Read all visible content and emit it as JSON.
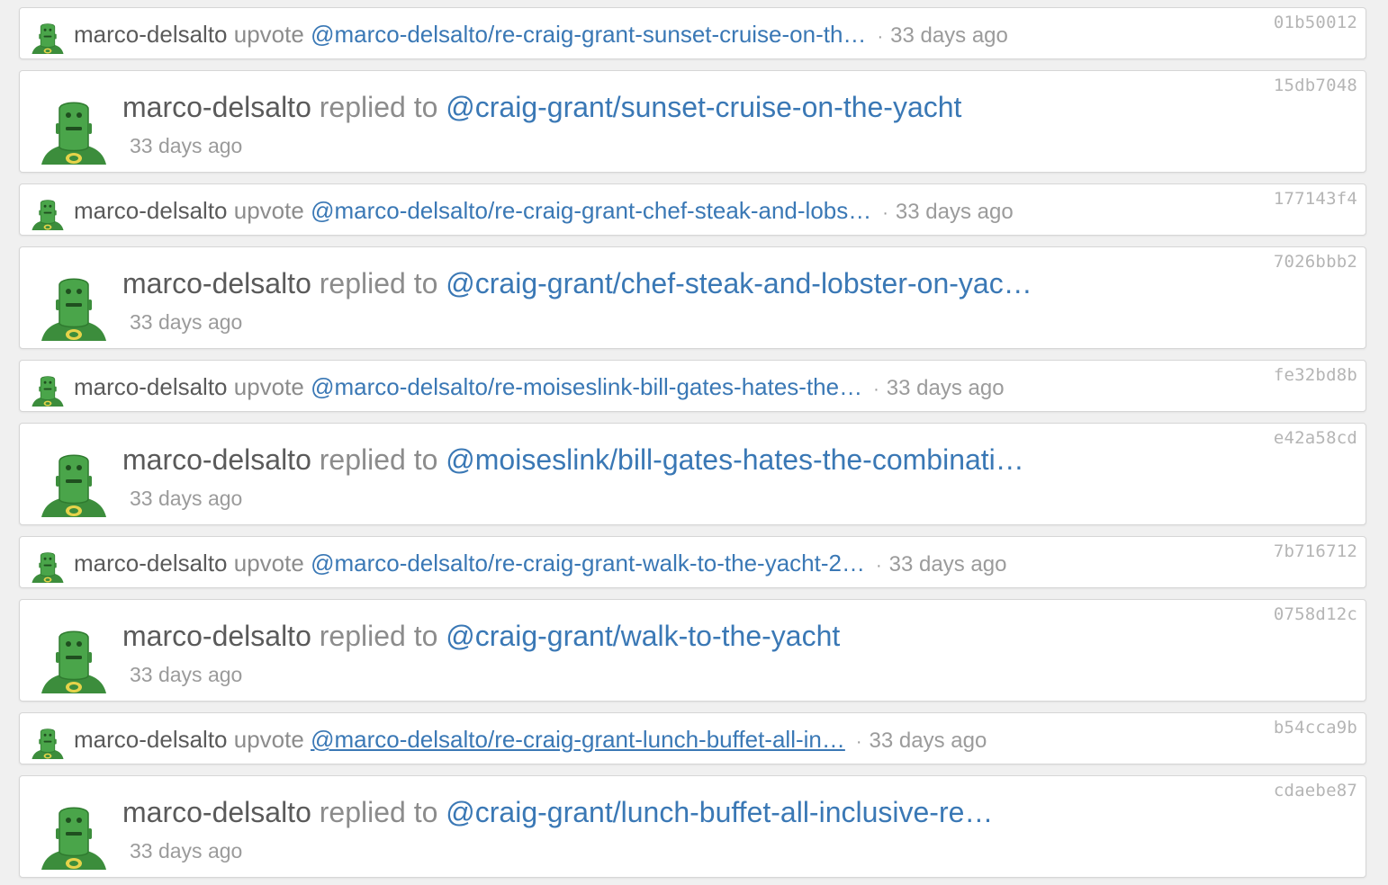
{
  "colors": {
    "background": "#f0f0f0",
    "card": "#ffffff",
    "link": "#3a78b5",
    "username": "#5a5a5a",
    "muted": "#9b9b9b",
    "hash": "#b5b5b5",
    "avatar_green": "#4aa54a"
  },
  "avatar_icon": "green-robot-avatar-icon",
  "feed": [
    {
      "type": "upvote",
      "user": "marco-delsalto",
      "verb": "upvote",
      "link": "@marco-delsalto/re-craig-grant-sunset-cruise-on-th…",
      "separator": "·",
      "time": "33 days ago",
      "hash": "01b50012"
    },
    {
      "type": "reply",
      "user": "marco-delsalto",
      "verb": "replied to",
      "link": "@craig-grant/sunset-cruise-on-the-yacht",
      "time": "33 days ago",
      "hash": "15db7048"
    },
    {
      "type": "upvote",
      "user": "marco-delsalto",
      "verb": "upvote",
      "link": "@marco-delsalto/re-craig-grant-chef-steak-and-lobs…",
      "separator": "·",
      "time": "33 days ago",
      "hash": "177143f4"
    },
    {
      "type": "reply",
      "user": "marco-delsalto",
      "verb": "replied to",
      "link": "@craig-grant/chef-steak-and-lobster-on-yac…",
      "time": "33 days ago",
      "hash": "7026bbb2"
    },
    {
      "type": "upvote",
      "user": "marco-delsalto",
      "verb": "upvote",
      "link": "@marco-delsalto/re-moiseslink-bill-gates-hates-the…",
      "separator": "·",
      "time": "33 days ago",
      "hash": "fe32bd8b"
    },
    {
      "type": "reply",
      "user": "marco-delsalto",
      "verb": "replied to",
      "link": "@moiseslink/bill-gates-hates-the-combinati…",
      "time": "33 days ago",
      "hash": "e42a58cd"
    },
    {
      "type": "upvote",
      "user": "marco-delsalto",
      "verb": "upvote",
      "link": "@marco-delsalto/re-craig-grant-walk-to-the-yacht-2…",
      "separator": "·",
      "time": "33 days ago",
      "hash": "7b716712"
    },
    {
      "type": "reply",
      "user": "marco-delsalto",
      "verb": "replied to",
      "link": "@craig-grant/walk-to-the-yacht",
      "time": "33 days ago",
      "hash": "0758d12c"
    },
    {
      "type": "upvote",
      "user": "marco-delsalto",
      "verb": "upvote",
      "link": "@marco-delsalto/re-craig-grant-lunch-buffet-all-in…",
      "separator": "·",
      "time": "33 days ago",
      "hash": "b54cca9b",
      "hovered": true
    },
    {
      "type": "reply",
      "user": "marco-delsalto",
      "verb": "replied to",
      "link": "@craig-grant/lunch-buffet-all-inclusive-re…",
      "time": "33 days ago",
      "hash": "cdaebe87"
    }
  ]
}
